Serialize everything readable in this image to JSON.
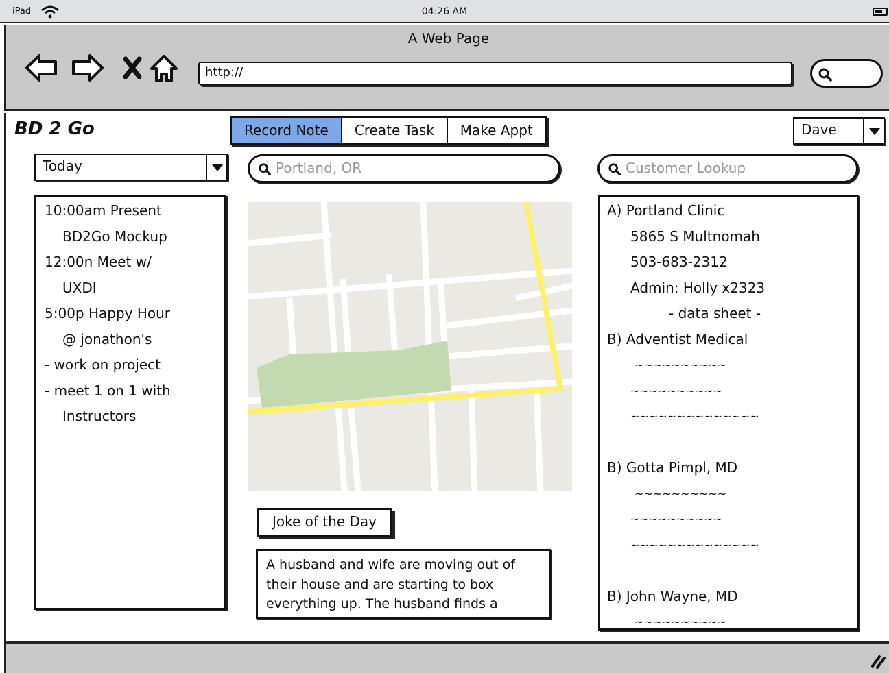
{
  "status": {
    "carrier": "iPad",
    "time": "04:26 AM"
  },
  "browser": {
    "title": "A Web Page",
    "url": "http://"
  },
  "app": {
    "brand": "BD 2 Go",
    "tabs": [
      {
        "label": "Record Note",
        "selected": true
      },
      {
        "label": "Create Task",
        "selected": false
      },
      {
        "label": "Make Appt",
        "selected": false
      }
    ],
    "user": "Dave"
  },
  "schedule": {
    "range": "Today",
    "lines": [
      "10:00am Present",
      "BD2Go Mockup",
      "12:00n Meet w/",
      "UXDI",
      "5:00p Happy Hour",
      "@ jonathon's",
      "- work on project",
      "- meet 1 on 1 with",
      "Instructors"
    ]
  },
  "map": {
    "search_placeholder": "Portland, OR"
  },
  "joke": {
    "button_label": "Joke of the Day",
    "text": "A husband and wife are moving out of their house and are starting to box everything up. The husband finds a"
  },
  "customers": {
    "search_placeholder": "Customer Lookup",
    "lines": [
      "A) Portland Clinic",
      "5865 S Multnomah",
      "503-683-2312",
      "Admin: Holly  x2323",
      "- data sheet -",
      "B) Adventist Medical",
      "~~~~~~~~~~",
      "~~~~~~~~~~",
      "~~~~~~~~~~~~~~",
      "",
      "B) Gotta Pimpl, MD",
      "~~~~~~~~~~",
      "~~~~~~~~~~",
      "~~~~~~~~~~~~~~",
      "",
      "B) John Wayne, MD",
      "~~~~~~~~~~"
    ]
  },
  "colors": {
    "selected_tab": "#7ea7e8",
    "chrome": "#c9c9c9",
    "map_road": "#fff06a",
    "map_park": "#c3d9b0",
    "map_bg": "#ebe9e4"
  },
  "icons": [
    "wifi-icon",
    "battery-icon",
    "back-arrow-icon",
    "forward-arrow-icon",
    "stop-icon",
    "home-icon",
    "search-icon",
    "dropdown-arrow-icon",
    "resize-grip-icon"
  ]
}
